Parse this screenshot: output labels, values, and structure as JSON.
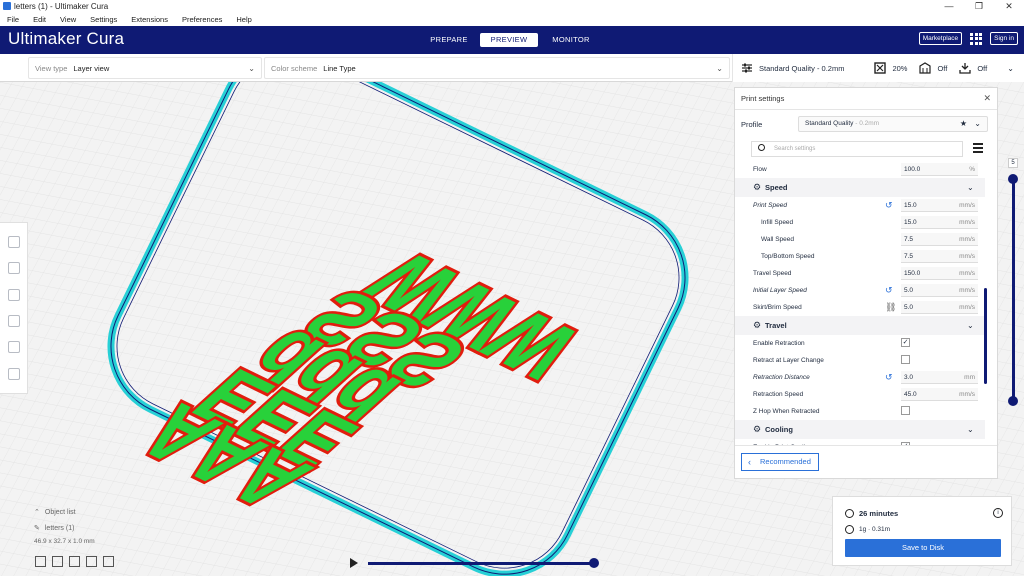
{
  "window": {
    "title": "letters (1) - Ultimaker Cura",
    "controls": [
      "—",
      "❐",
      "✕"
    ]
  },
  "menu": [
    "File",
    "Edit",
    "View",
    "Settings",
    "Extensions",
    "Preferences",
    "Help"
  ],
  "header": {
    "brand": "Ultimaker Cura",
    "tabs": [
      "PREPARE",
      "PREVIEW",
      "MONITOR"
    ],
    "active_tab": "PREVIEW",
    "marketplace": "Marketplace",
    "signin": "Sign in"
  },
  "toolbar": {
    "view_type_label": "View type",
    "view_type_value": "Layer view",
    "color_scheme_label": "Color scheme",
    "color_scheme_value": "Line Type",
    "quality": "Standard Quality - 0.2mm",
    "infill": "20%",
    "support": "Off",
    "adhesion": "Off"
  },
  "panel": {
    "title": "Print settings",
    "profile_label": "Profile",
    "profile_value": "Standard Quality",
    "profile_sub": "- 0.2mm",
    "search_placeholder": "Search settings",
    "settings": [
      {
        "type": "setting",
        "name": "Flow",
        "value": "100.0",
        "unit": "%"
      },
      {
        "type": "category",
        "name": "Speed",
        "icon": "speedometer-icon"
      },
      {
        "type": "setting",
        "name": "Print Speed",
        "value": "15.0",
        "unit": "mm/s",
        "italic": true,
        "reset": true
      },
      {
        "type": "setting",
        "name": "Infill Speed",
        "value": "15.0",
        "unit": "mm/s",
        "indent": true
      },
      {
        "type": "setting",
        "name": "Wall Speed",
        "value": "7.5",
        "unit": "mm/s",
        "indent": true
      },
      {
        "type": "setting",
        "name": "Top/Bottom Speed",
        "value": "7.5",
        "unit": "mm/s",
        "indent": true
      },
      {
        "type": "setting",
        "name": "Travel Speed",
        "value": "150.0",
        "unit": "mm/s"
      },
      {
        "type": "setting",
        "name": "Initial Layer Speed",
        "value": "5.0",
        "unit": "mm/s",
        "italic": true,
        "reset": true
      },
      {
        "type": "setting",
        "name": "Skirt/Brim Speed",
        "value": "5.0",
        "unit": "mm/s",
        "link": true
      },
      {
        "type": "category",
        "name": "Travel",
        "icon": "travel-icon"
      },
      {
        "type": "check",
        "name": "Enable Retraction",
        "checked": true
      },
      {
        "type": "check",
        "name": "Retract at Layer Change",
        "checked": false
      },
      {
        "type": "setting",
        "name": "Retraction Distance",
        "value": "3.0",
        "unit": "mm",
        "italic": true,
        "reset": true
      },
      {
        "type": "setting",
        "name": "Retraction Speed",
        "value": "45.0",
        "unit": "mm/s"
      },
      {
        "type": "check",
        "name": "Z Hop When Retracted",
        "checked": false
      },
      {
        "type": "category",
        "name": "Cooling",
        "icon": "fan-icon"
      },
      {
        "type": "check",
        "name": "Enable Print Cooling",
        "checked": true
      }
    ],
    "recommended": "Recommended"
  },
  "object_list": {
    "title": "Object list",
    "item": "letters (1)",
    "dims": "46.9 x 32.7 x 1.0 mm"
  },
  "layer_slider": {
    "current_layer": "5",
    "level": 1.0
  },
  "summary": {
    "time": "26 minutes",
    "material": "1g · 0.31m",
    "save": "Save to Disk"
  },
  "colors": {
    "header": "#0f1a74",
    "accent": "#2a70d8",
    "skirt": "#27d0d6",
    "wall": "#e11d0e",
    "infill": "#28d13a"
  }
}
